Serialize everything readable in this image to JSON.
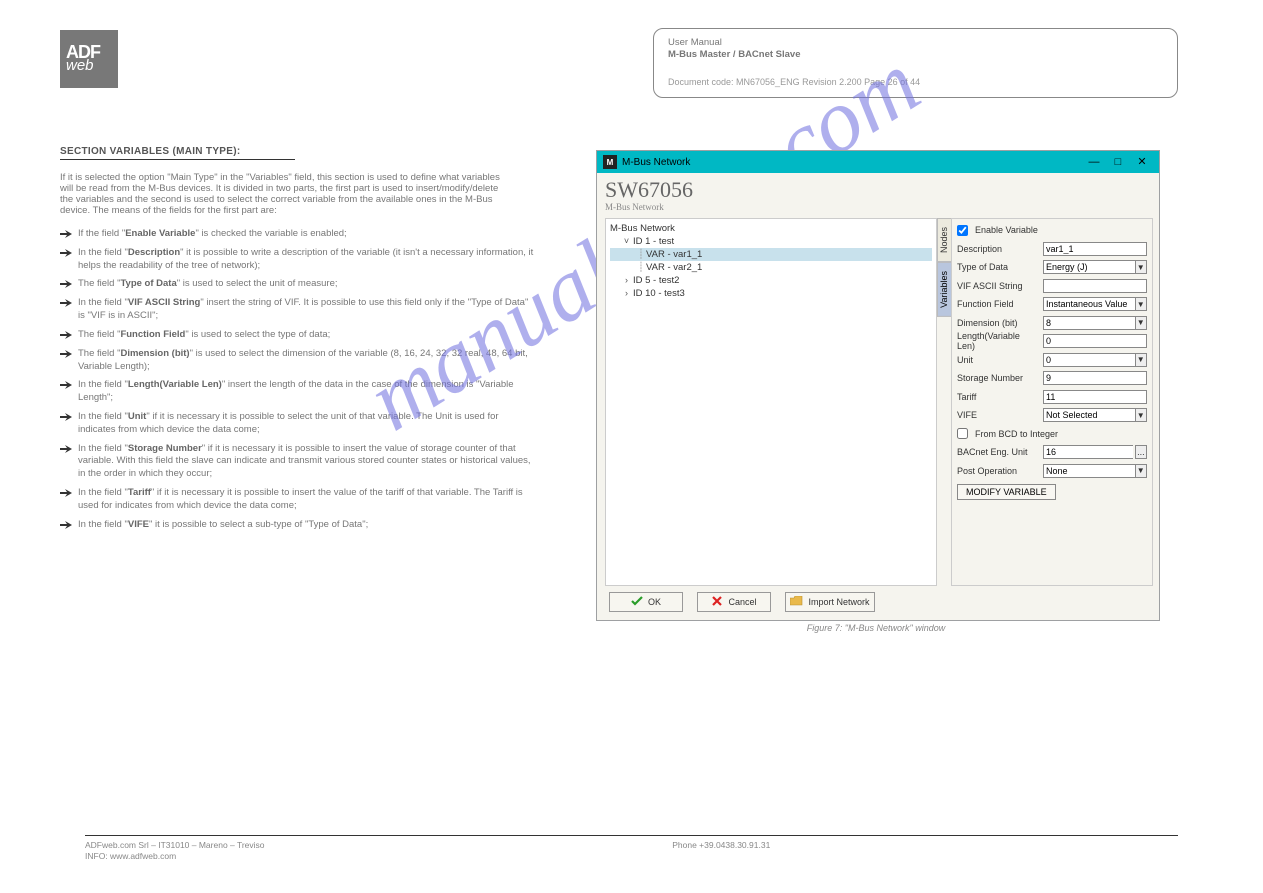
{
  "hdr": {
    "l1": "User Manual",
    "l2": "M-Bus Master / BACnet Slave",
    "doc": "Document code: MN67056_ENG Revision 2.200 Page 26 of 44"
  },
  "section": "SECTION VARIABLES (MAIN TYPE):",
  "intro": "If it is selected the option \"Main Type\" in the \"Variables\" field, this section is used to define what variables will be read from the M-Bus devices. It is divided in two parts, the first part is used to insert/modify/delete the variables and the second is used to select the correct variable from the available ones in the M-Bus device. The means of the fields for the first part are:",
  "bullets": [
    "If the field \"<b>Enable Variable</b>\" is checked the variable is enabled;",
    "In the field \"<b>Description</b>\" it is possible to write a description of the variable (it isn't a necessary information, it helps the readability of the tree of network);",
    "The field \"<b>Type of Data</b>\" is used to select the unit of measure;",
    "In the field \"<b>VIF ASCII String</b>\" insert the string of VIF. It is possible to use this field only if the \"Type of Data\" is \"VIF is in ASCII\";",
    "The field \"<b>Function Field</b>\" is used to select the type of data;",
    "The field \"<b>Dimension (bit)</b>\" is used to select the dimension of the variable (8, 16, 24, 32, 32 real, 48, 64 bit, Variable Length);",
    "In the field \"<b>Length(Variable Len)</b>\" insert the length of the data in the case of the dimension is \"Variable Length\";",
    "In the field \"<b>Unit</b>\" if it is necessary it is possible to select the unit of that variable. The Unit is used for indicates from which device the data come;",
    "In the field \"<b>Storage Number</b>\" if it is necessary it is possible to insert the value of storage counter of that variable. With this field the slave can indicate and transmit various stored counter states or historical values, in the order in which they occur;",
    "In the field \"<b>Tariff</b>\" if it is necessary it is possible to insert the value of the tariff of that variable. The Tariff is used for indicates from which device the data come;",
    "In the field \"<b>VIFE</b>\" it is possible to select a sub-type of \"Type of Data\";"
  ],
  "watermark": "manualshive.com",
  "win": {
    "title": "M-Bus Network",
    "sw": "SW67056",
    "sub": "M-Bus Network",
    "wb": {
      "min": "—",
      "max": "□",
      "close": "✕"
    }
  },
  "tree": {
    "root": "M-Bus Network",
    "n1": "ID 1 - test",
    "v11": "VAR - var1_1",
    "v12": "VAR - var2_1",
    "n2": "ID 5 - test2",
    "n3": "ID 10 - test3"
  },
  "tabs": {
    "nodes": "Nodes",
    "vars": "Variables"
  },
  "form": {
    "enable": "Enable Variable",
    "descL": "Description",
    "descV": "var1_1",
    "typeL": "Type of Data",
    "typeV": "Energy (J)",
    "vifsL": "VIF ASCII String",
    "vifsV": "",
    "funcL": "Function Field",
    "funcV": "Instantaneous Value",
    "dimL": "Dimension (bit)",
    "dimV": "8",
    "lenL": "Length(Variable Len)",
    "lenV": "0",
    "unitL": "Unit",
    "unitV": "0",
    "storL": "Storage Number",
    "storV": "9",
    "tarL": "Tariff",
    "tarV": "11",
    "vifeL": "VIFE",
    "vifeV": "Not Selected",
    "bcd": "From BCD to Integer",
    "bacL": "BACnet Eng. Unit",
    "bacV": "16",
    "postL": "Post Operation",
    "postV": "None",
    "dd": "▼",
    "dots": "...",
    "modify": "MODIFY VARIABLE"
  },
  "btns": {
    "ok": "OK",
    "cancel": "Cancel",
    "import": "Import Network"
  },
  "figcap": "Figure 7: \"M-Bus Network\" window",
  "footer": {
    "leftL1": "ADFweb.com Srl – IT31010 – Mareno – Treviso",
    "leftL2": "INFO: www.adfweb.com",
    "mid": "Phone +39.0438.30.91.31",
    "rightL1": "",
    "rightL2": ""
  }
}
